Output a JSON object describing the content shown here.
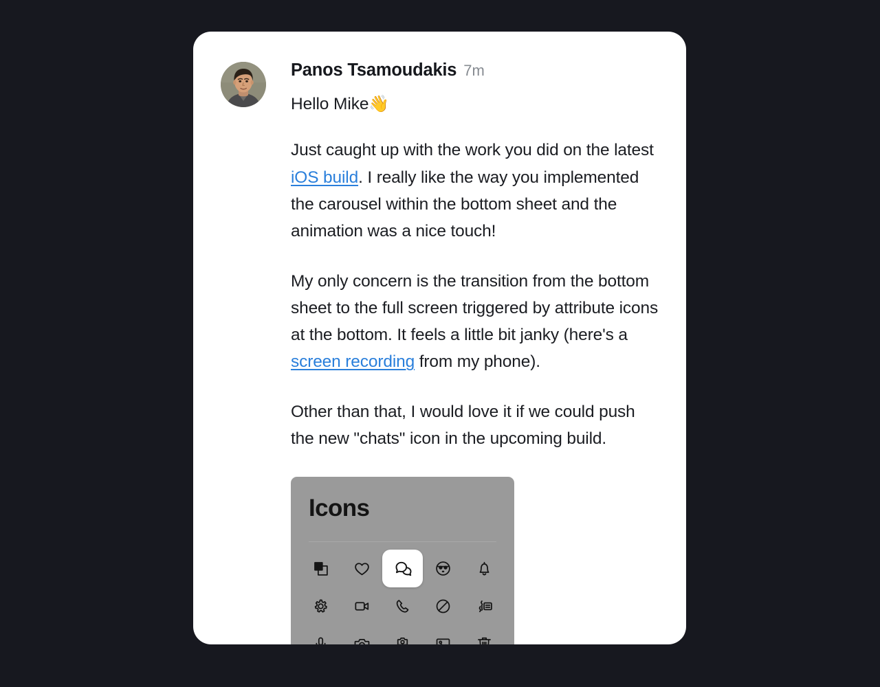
{
  "theme": {
    "background": "#17181f",
    "card_background": "#ffffff",
    "text_color": "#1b1d22",
    "link_color": "#2a7fdb",
    "timestamp_color": "#868b91",
    "attachment_background": "#9a9a9a",
    "selected_tile_background": "#ffffff"
  },
  "message": {
    "sender": "Panos Tsamoudakis",
    "timestamp": "7m",
    "avatar_alt": "Panos Tsamoudakis profile photo",
    "greeting_text": "Hello Mike",
    "greeting_emoji": "👋",
    "paragraphs": [
      {
        "segments": [
          {
            "type": "text",
            "text": "Just caught up with the work you did on the latest "
          },
          {
            "type": "link",
            "text": "iOS build"
          },
          {
            "type": "text",
            "text": ". I really like the way you implemented the carousel within the bottom sheet and the animation was a nice touch!"
          }
        ]
      },
      {
        "segments": [
          {
            "type": "text",
            "text": "My only concern is the transition from the bottom sheet to the full screen triggered by attribute icons at the bottom. It feels a little bit janky (here's a "
          },
          {
            "type": "link",
            "text": "screen recording"
          },
          {
            "type": "text",
            "text": " from my phone)."
          }
        ]
      },
      {
        "segments": [
          {
            "type": "text",
            "text": "Other than that, I would love it if we could push the new \"chats\" icon in the upcoming build."
          }
        ]
      }
    ]
  },
  "attachment": {
    "title": "Icons",
    "icons": [
      {
        "name": "copy-icon",
        "label": "Copy",
        "selected": false
      },
      {
        "name": "heart-icon",
        "label": "Heart",
        "selected": false
      },
      {
        "name": "chats-icon",
        "label": "Chats",
        "selected": true
      },
      {
        "name": "smiley-sunglasses-icon",
        "label": "Smiley",
        "selected": false
      },
      {
        "name": "bell-icon",
        "label": "Bell",
        "selected": false
      },
      {
        "name": "gear-icon",
        "label": "Settings",
        "selected": false
      },
      {
        "name": "video-camera-icon",
        "label": "Video",
        "selected": false
      },
      {
        "name": "phone-icon",
        "label": "Phone",
        "selected": false
      },
      {
        "name": "prohibit-icon",
        "label": "Block",
        "selected": false
      },
      {
        "name": "voice-message-icon",
        "label": "Voice message",
        "selected": false
      },
      {
        "name": "microphone-icon",
        "label": "Microphone",
        "selected": false
      },
      {
        "name": "camera-icon",
        "label": "Camera",
        "selected": false
      },
      {
        "name": "camera-rotate-icon",
        "label": "Switch camera",
        "selected": false
      },
      {
        "name": "image-icon",
        "label": "Image",
        "selected": false
      },
      {
        "name": "trash-icon",
        "label": "Delete",
        "selected": false
      }
    ]
  }
}
